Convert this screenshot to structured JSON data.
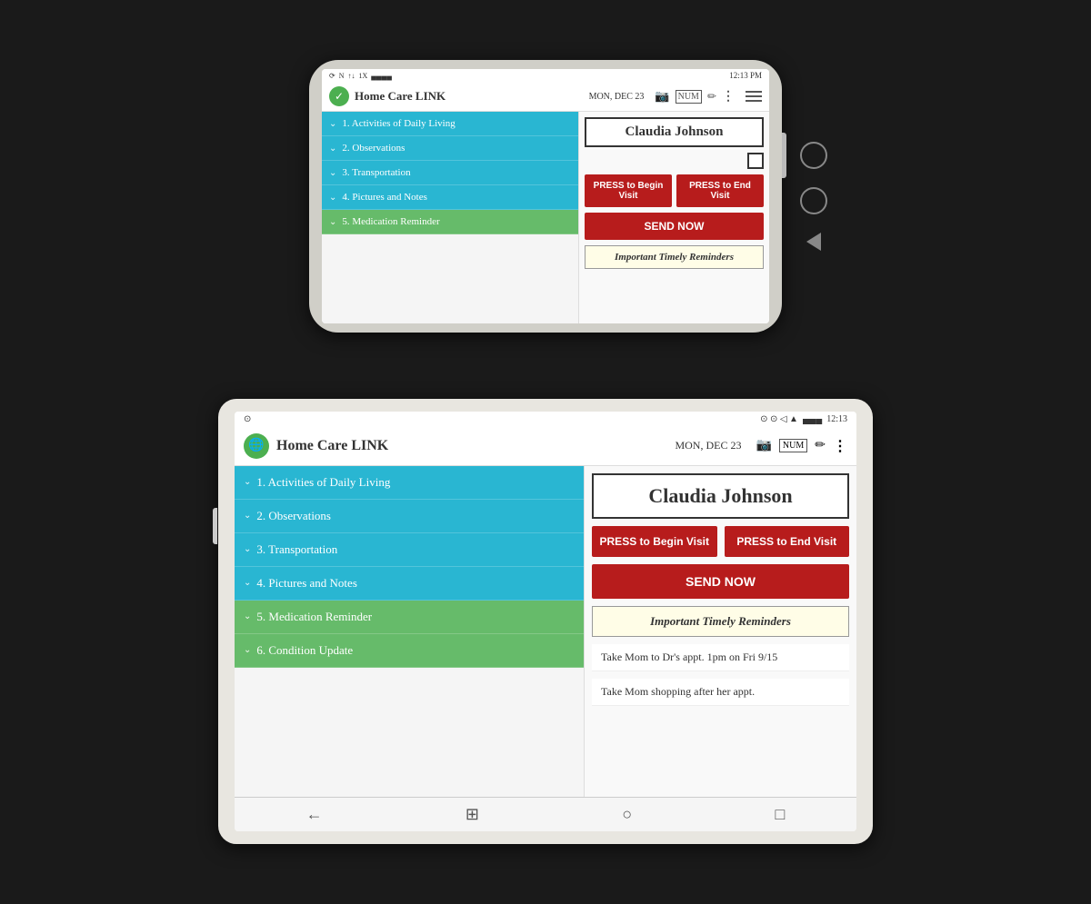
{
  "background_color": "#1a1a1a",
  "phone": {
    "status_bar": {
      "time": "12:13 PM",
      "date": "MON, DEC 23",
      "signal": "●●●●",
      "battery": "▐"
    },
    "app": {
      "title": "Home Care LINK",
      "logo_symbol": "✓",
      "patient_name": "Claudia Johnson",
      "menu_items": [
        {
          "label": "1. Activities of Daily Living",
          "color": "blue"
        },
        {
          "label": "2. Observations",
          "color": "blue"
        },
        {
          "label": "3. Transportation",
          "color": "blue"
        },
        {
          "label": "4. Pictures and Notes",
          "color": "blue"
        },
        {
          "label": "5. Medication Reminder",
          "color": "green"
        }
      ],
      "btn_begin": "PRESS to Begin Visit",
      "btn_end": "PRESS to End Visit",
      "btn_send": "SEND NOW",
      "reminders_label": "Important Timely Reminders"
    }
  },
  "tablet": {
    "status_bar": {
      "time": "12:13",
      "date": "MON, DEC 23",
      "signal": "●●●●"
    },
    "app": {
      "title": "Home Care LINK",
      "logo_symbol": "🌐",
      "patient_name": "Claudia Johnson",
      "menu_items": [
        {
          "label": "1. Activities of Daily Living",
          "color": "blue"
        },
        {
          "label": "2. Observations",
          "color": "blue"
        },
        {
          "label": "3. Transportation",
          "color": "blue"
        },
        {
          "label": "4. Pictures and Notes",
          "color": "blue"
        },
        {
          "label": "5. Medication Reminder",
          "color": "green"
        },
        {
          "label": "6. Condition Update",
          "color": "green"
        }
      ],
      "btn_begin": "PRESS to Begin Visit",
      "btn_end": "PRESS to End Visit",
      "btn_send": "SEND NOW",
      "reminders_label": "Important Timely Reminders",
      "reminder_items": [
        "Take Mom to Dr's appt. 1pm on Fri 9/15",
        "Take Mom shopping after her appt."
      ]
    },
    "bottom_nav": [
      "←",
      "⊞",
      "○",
      "□"
    ]
  }
}
